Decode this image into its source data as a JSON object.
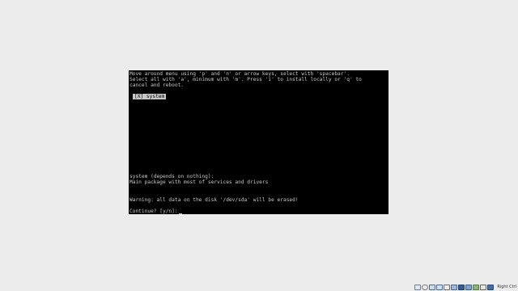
{
  "console": {
    "lines": [
      "Move around menu using 'p' and 'n' or arrow keys, select with 'spacebar'.",
      "Select all with 'a', minimum with 'm'. Press 'i' to install locally or 'q' to",
      "cancel and reboot."
    ],
    "menu_item": "[X] system",
    "description_lines": [
      "system (depends on nothing):",
      "Main package with most of services and drivers"
    ],
    "warning": "Warning: all data on the disk '/dev/sda' will be erased!",
    "prompt": "Continue? [y/n]:"
  },
  "statusbar": {
    "icons": [
      "hdd-icon",
      "optical-drive-icon",
      "audio-icon",
      "network-icon",
      "usb-icon",
      "shared-folder-icon",
      "display-icon",
      "video-capture-icon",
      "cpu-icon",
      "mouse-integration-icon",
      "keyboard-icon"
    ],
    "host_key": "Right Ctrl"
  },
  "colors": {
    "console_bg": "#000000",
    "console_fg": "#c8c8c8",
    "window_bg": "#ececec"
  }
}
